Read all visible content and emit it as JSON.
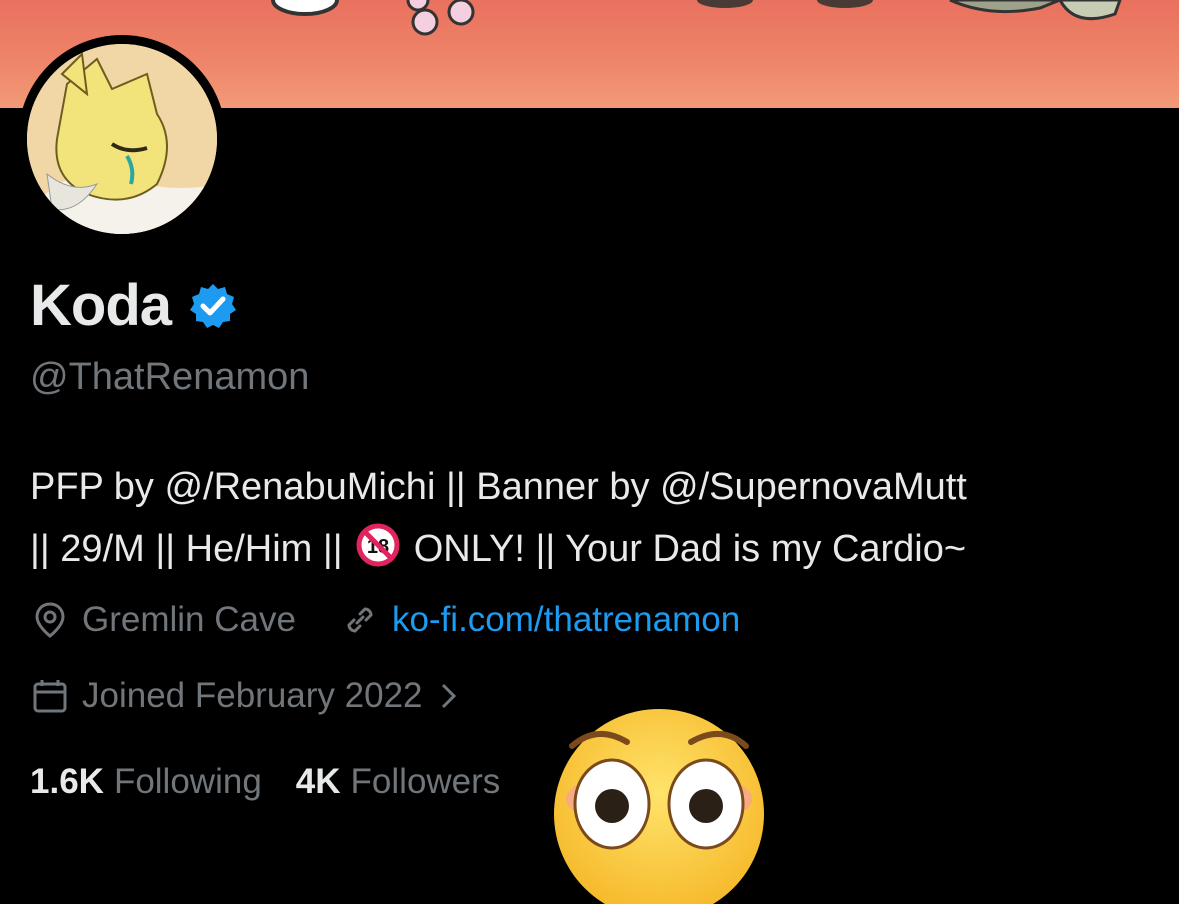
{
  "profile": {
    "display_name": "Koda",
    "handle": "@ThatRenamon",
    "verified": true,
    "bio_line1": "PFP by @/RenabuMichi || Banner by @/SupernovaMutt",
    "bio_line2_part1": "|| 29/M || He/Him ||",
    "bio_line2_part2": "ONLY! || Your Dad is my Cardio~",
    "location": "Gremlin Cave",
    "website": "ko-fi.com/thatrenamon",
    "joined": "Joined February 2022",
    "following_count": "1.6K",
    "following_label": "Following",
    "followers_count": "4K",
    "followers_label": "Followers"
  },
  "icons": {
    "verified": "verified-badge-icon",
    "adult": "no-one-under-18-icon",
    "location": "location-pin-icon",
    "link": "link-icon",
    "calendar": "calendar-icon",
    "chevron": "chevron-right-icon",
    "emoji": "flushed-face-emoji"
  },
  "colors": {
    "background": "#000000",
    "text_primary": "#e7e9ea",
    "text_secondary": "#71767b",
    "link": "#1d9bf0",
    "verified": "#1d9bf0",
    "banner": "#ee8468"
  }
}
